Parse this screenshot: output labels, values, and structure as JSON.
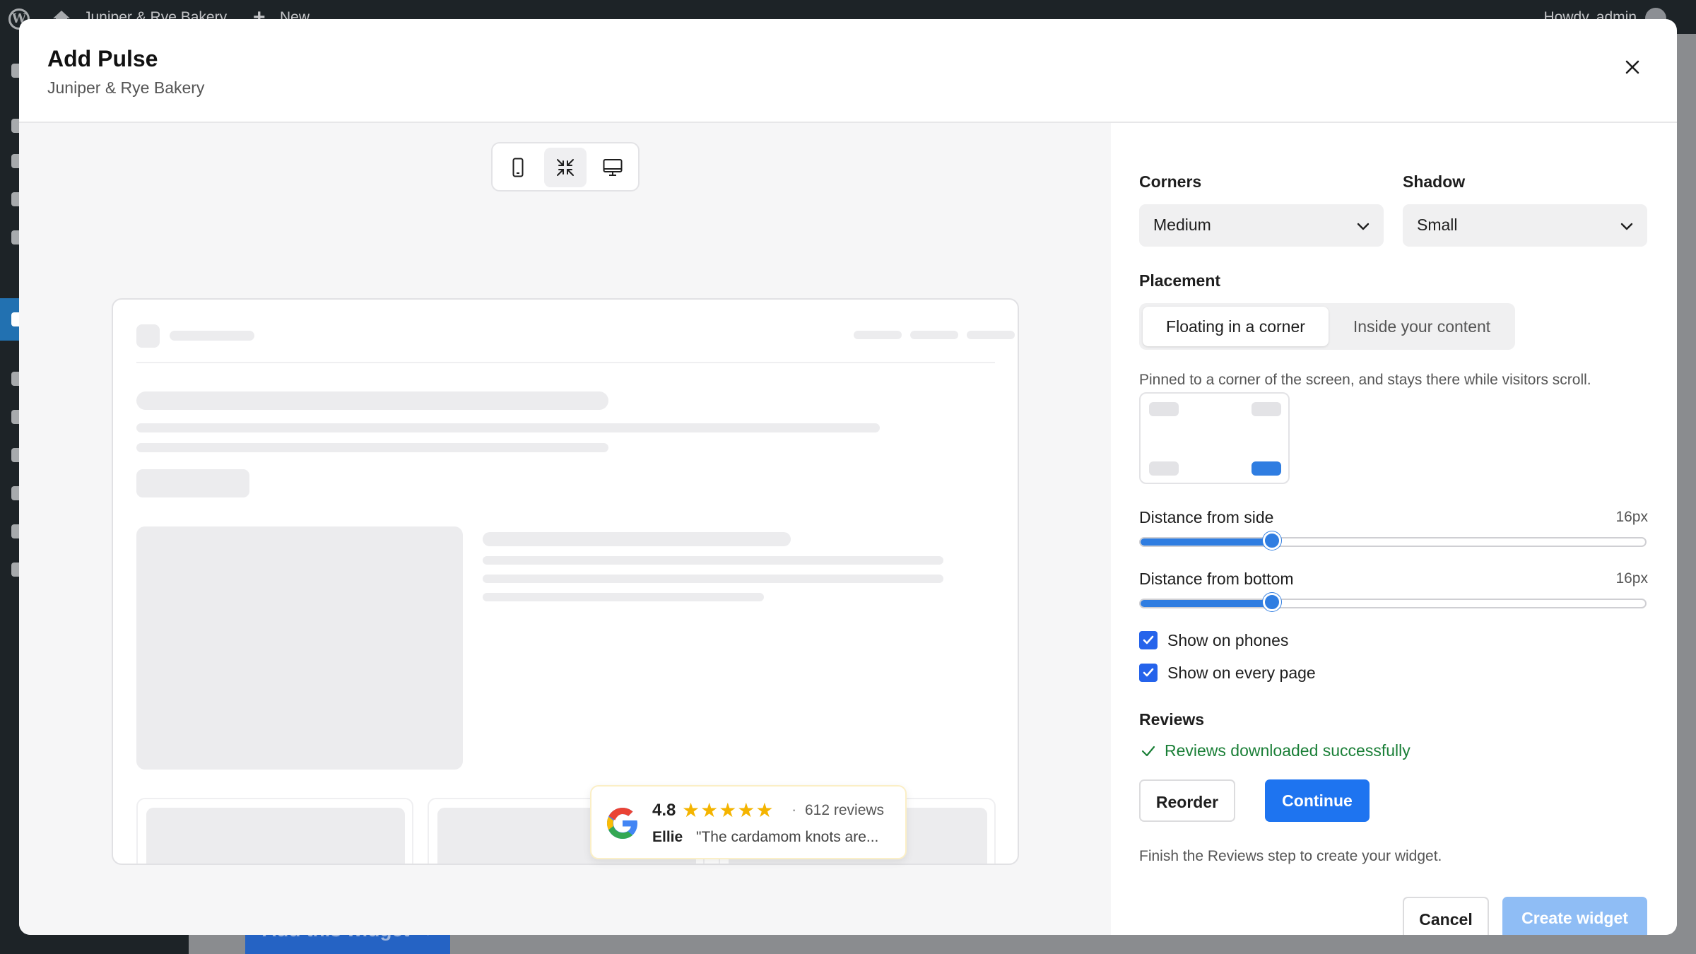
{
  "adminbar": {
    "site_name": "Juniper & Rye Bakery",
    "new_label": "New",
    "howdy": "Howdy, admin"
  },
  "backdrop": {
    "under_button": "Add this widget →"
  },
  "modal": {
    "title": "Add Pulse",
    "subtitle": "Juniper & Rye Bakery",
    "close_icon": "close-icon"
  },
  "preview": {
    "devices": [
      {
        "name": "phone",
        "icon": "phone-icon",
        "selected": false
      },
      {
        "name": "compact",
        "icon": "collapse-arrows-icon",
        "selected": true
      },
      {
        "name": "desktop",
        "icon": "desktop-icon",
        "selected": false
      }
    ],
    "pulse": {
      "rating": "4.8",
      "stars": "★★★★★",
      "separator": "·",
      "review_count": "612 reviews",
      "author": "Ellie",
      "quote": "\"The cardamom knots are..."
    }
  },
  "settings": {
    "corners": {
      "label": "Corners",
      "value": "Medium"
    },
    "shadow": {
      "label": "Shadow",
      "value": "Small"
    },
    "placement": {
      "label": "Placement",
      "options": [
        "Floating in a corner",
        "Inside your content"
      ],
      "selected": "Floating in a corner",
      "help": "Pinned to a corner of the screen, and stays there while visitors scroll.",
      "selected_corner": "bottom-right"
    },
    "distance_side": {
      "label": "Distance from side",
      "value": "16px",
      "level": 0.26
    },
    "distance_bottom": {
      "label": "Distance from bottom",
      "value": "16px",
      "level": 0.26
    },
    "show_on_phones": {
      "label": "Show on phones",
      "checked": true
    },
    "show_on_every_page": {
      "label": "Show on every page",
      "checked": true
    },
    "reviews": {
      "label": "Reviews",
      "status": "Reviews downloaded successfully",
      "reorder_label": "Reorder",
      "continue_label": "Continue",
      "hint": "Finish the Reviews step to create your widget."
    },
    "footer": {
      "cancel_label": "Cancel",
      "create_label": "Create widget"
    }
  },
  "colors": {
    "accent": "#1e74f0",
    "success": "#1a7f37",
    "star": "#f4b400",
    "disabled_button": "#8fbdf5"
  }
}
